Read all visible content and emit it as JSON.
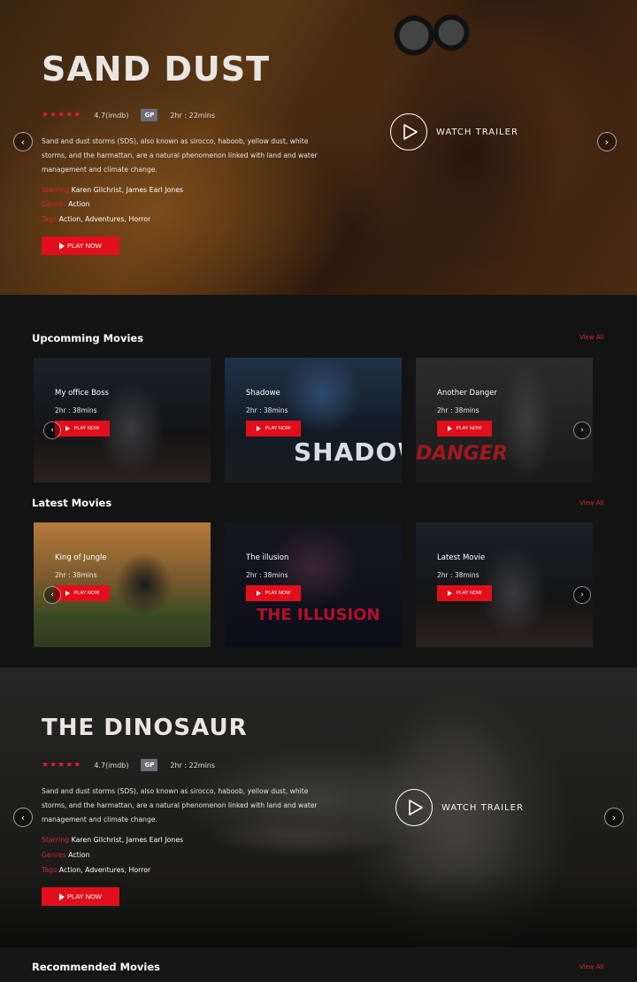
{
  "hero1": {
    "title": "SAND DUST",
    "stars": "★★★★★",
    "rating": "4.7(imdb)",
    "badge": "GP",
    "duration": "2hr : 22mins",
    "description": "Sand and dust storms (SDS), also known as sirocco, haboob, yellow dust, white storms, and the harmattan, are a natural phenomenon linked with land and water management and climate change.",
    "starring_label": "Starring",
    "starring": "Karen Gilchrist, James Earl Jones",
    "genres_label": "Genres",
    "genres": "Action",
    "tags_label": "Tags",
    "tags": "Action, Adventures, Horror",
    "play_label": "PLAY NOW",
    "trailer_label": "WATCH TRAILER",
    "prev_icon": "‹",
    "next_icon": "›"
  },
  "upcoming": {
    "title": "Upcomming Movies",
    "view_all": "View All",
    "movies": [
      {
        "title": "My office Boss",
        "duration": "2hr : 38mins",
        "play": "PLAY NOW"
      },
      {
        "title": "Shadowe",
        "duration": "2hr : 38mins",
        "play": "PLAY NOW"
      },
      {
        "title": "Another Danger",
        "duration": "2hr : 38mins",
        "play": "PLAY NOW"
      }
    ],
    "deco": {
      "shadow": "SHADOW",
      "danger": "DANGER"
    }
  },
  "latest": {
    "title": "Latest Movies",
    "view_all": "View All",
    "movies": [
      {
        "title": "King of Jungle",
        "duration": "2hr : 38mins",
        "play": "PLAY NOW"
      },
      {
        "title": "The illusion",
        "duration": "2hr : 38mins",
        "play": "PLAY NOW"
      },
      {
        "title": "Latest Movie",
        "duration": "2hr : 38mins",
        "play": "PLAY NOW"
      }
    ],
    "deco": {
      "illusion": "THE ILLUSION"
    }
  },
  "hero2": {
    "title": "THE DINOSAUR",
    "stars": "★★★★★",
    "rating": "4.7(imdb)",
    "badge": "GP",
    "duration": "2hr : 22mins",
    "description": "Sand and dust storms (SDS), also known as sirocco, haboob, yellow dust, white storms, and the harmattan, are a natural phenomenon linked with land and water management and climate change.",
    "starring_label": "Starring",
    "starring": "Karen Gilchrist, James Earl Jones",
    "genres_label": "Genres",
    "genres": "Action",
    "tags_label": "Tags",
    "tags": "Action, Adventures, Horror",
    "play_label": "PLAY NOW",
    "trailer_label": "WATCH TRAILER",
    "prev_icon": "‹",
    "next_icon": "›"
  },
  "recommended": {
    "title": "Recommended Movies",
    "view_all": "View All"
  },
  "colors": {
    "accent": "#e10f1b",
    "label_red": "#d6262f",
    "background": "#131313"
  }
}
